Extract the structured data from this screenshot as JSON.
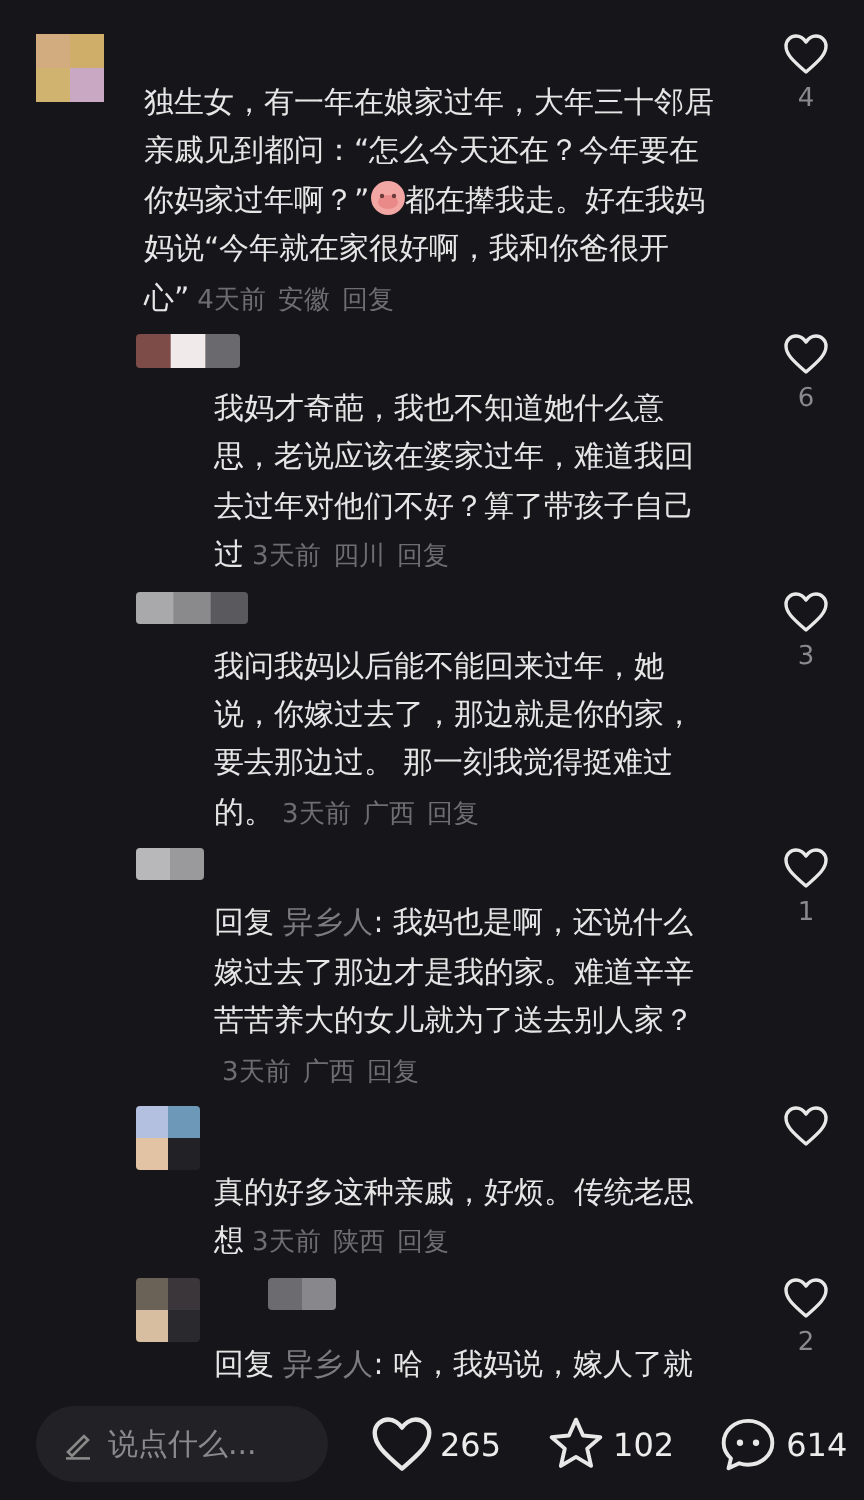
{
  "comments": [
    {
      "kind": "main",
      "segments": [
        {
          "kind": "text",
          "text": "独生女，有一年在娘家过年，大年三十邻居亲戚见到都问：“怎么今天还在？今年要在你妈家过年啊？”"
        },
        {
          "kind": "emoji"
        },
        {
          "kind": "text",
          "text": "都在撵我走。好在我妈妈说“今年就在家很好啊，我和你爸很开心”"
        }
      ],
      "time": "4天前",
      "location": "安徽",
      "reply": "回复",
      "likes": "4"
    },
    {
      "kind": "reply",
      "segments": [
        {
          "kind": "text",
          "text": "我妈才奇葩，我也不知道她什么意思，老说应该在婆家过年，难道我回去过年对他们不好？算了带孩子自己过"
        }
      ],
      "time": "3天前",
      "location": "四川",
      "reply": "回复",
      "likes": "6"
    },
    {
      "kind": "reply",
      "segments": [
        {
          "kind": "text",
          "text": "我问我妈以后能不能回来过年，她说，你嫁过去了，那边就是你的家，要去那边过。 那一刻我觉得挺难过的。"
        }
      ],
      "time": "3天前",
      "location": "广西",
      "reply": "回复",
      "likes": "3"
    },
    {
      "kind": "reply",
      "reply_prefix": "回复",
      "reply_to": "异乡人",
      "segments": [
        {
          "kind": "text",
          "text": ": 我妈也是啊，还说什么嫁过去了那边才是我的家。难道辛辛苦苦养大的女儿就为了送去别人家？"
        }
      ],
      "time": "3天前",
      "location": "广西",
      "reply": "回复",
      "likes": "1"
    },
    {
      "kind": "reply",
      "segments": [
        {
          "kind": "text",
          "text": "真的好多这种亲戚，好烦。传统老思想"
        }
      ],
      "time": "3天前",
      "location": "陕西",
      "reply": "回复"
    },
    {
      "kind": "reply",
      "reply_prefix": "回复",
      "reply_to": "异乡人",
      "segments": [
        {
          "kind": "text",
          "text": ": 哈，我妈说，嫁人了就"
        }
      ],
      "likes": "2"
    }
  ],
  "bottom_bar": {
    "input": {
      "placeholder": "说点什么..."
    },
    "likes": "265",
    "favorites": "102",
    "comments": "614"
  }
}
